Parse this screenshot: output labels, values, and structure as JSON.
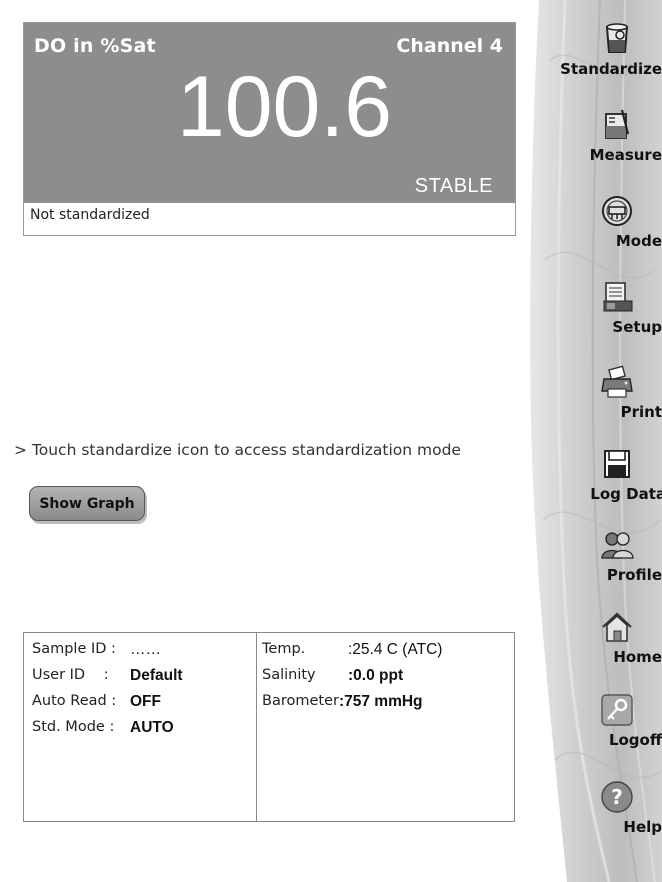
{
  "reading": {
    "parameter": "DO in  %Sat",
    "channel": "Channel 4",
    "value": "100.6",
    "stability": "STABLE",
    "standardization_status": "Not standardized"
  },
  "hint": "> Touch standardize icon to access standardization mode",
  "graph_button": {
    "label": "Show Graph"
  },
  "info": {
    "left": [
      {
        "label": "Sample ID",
        "sep": ":",
        "value": "……"
      },
      {
        "label": "User ID",
        "sep": ":",
        "value": "Default"
      },
      {
        "label": "Auto Read",
        "sep": ":",
        "value": "OFF"
      },
      {
        "label": "Std. Mode",
        "sep": ":",
        "value": "AUTO"
      }
    ],
    "right": [
      {
        "label": "Temp.",
        "value": ":25.4 C (ATC)"
      },
      {
        "label": "Salinity",
        "value": ":0.0 ppt"
      },
      {
        "label": "Barometer",
        "value": ":757 mmHg"
      }
    ]
  },
  "sidebar": {
    "items": [
      {
        "label": "Standardize",
        "icon": "standardize-beaker-icon"
      },
      {
        "label": "Measure",
        "icon": "measure-beaker-icon"
      },
      {
        "label": "Mode",
        "icon": "mode-icon"
      },
      {
        "label": "Setup",
        "icon": "setup-icon"
      },
      {
        "label": "Print",
        "icon": "printer-icon"
      },
      {
        "label": "Log Data",
        "icon": "floppy-disk-icon"
      },
      {
        "label": "Profile",
        "icon": "profile-users-icon"
      },
      {
        "label": "Home",
        "icon": "home-icon"
      },
      {
        "label": "Logoff",
        "icon": "key-icon"
      },
      {
        "label": "Help",
        "icon": "help-icon"
      }
    ]
  }
}
